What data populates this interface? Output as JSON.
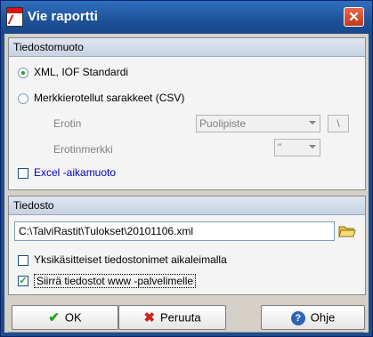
{
  "window": {
    "title": "Vie raportti",
    "close_glyph": "✕"
  },
  "format_group": {
    "title": "Tiedostomuoto",
    "option_xml": "XML, IOF Standardi",
    "option_csv": "Merkkierotellut sarakkeet (CSV)",
    "separator_label": "Erotin",
    "separator_value": "Puolipiste",
    "separator_char": "\\",
    "text_marker_label": "Erotinmerkki",
    "text_marker_value": "\"",
    "excel_time_label": "Excel -aikamuoto"
  },
  "file_group": {
    "title": "Tiedosto",
    "path": "C:\\TalviRastit\\Tulokset\\20101106.xml",
    "individual_files_label": "Yksikäsitteiset tiedostonimet aikaleimalla",
    "upload_label": "Siirrä tiedostot www -palvelimelle"
  },
  "buttons": {
    "ok": "OK",
    "cancel": "Peruuta",
    "help": "Ohje",
    "ok_icon_glyph": "✔",
    "cancel_icon_glyph": "✖",
    "help_icon_glyph": "?"
  },
  "colors": {
    "title_bar": "#1f5299",
    "accent_link": "#0000cc",
    "check_green": "#21a121"
  }
}
